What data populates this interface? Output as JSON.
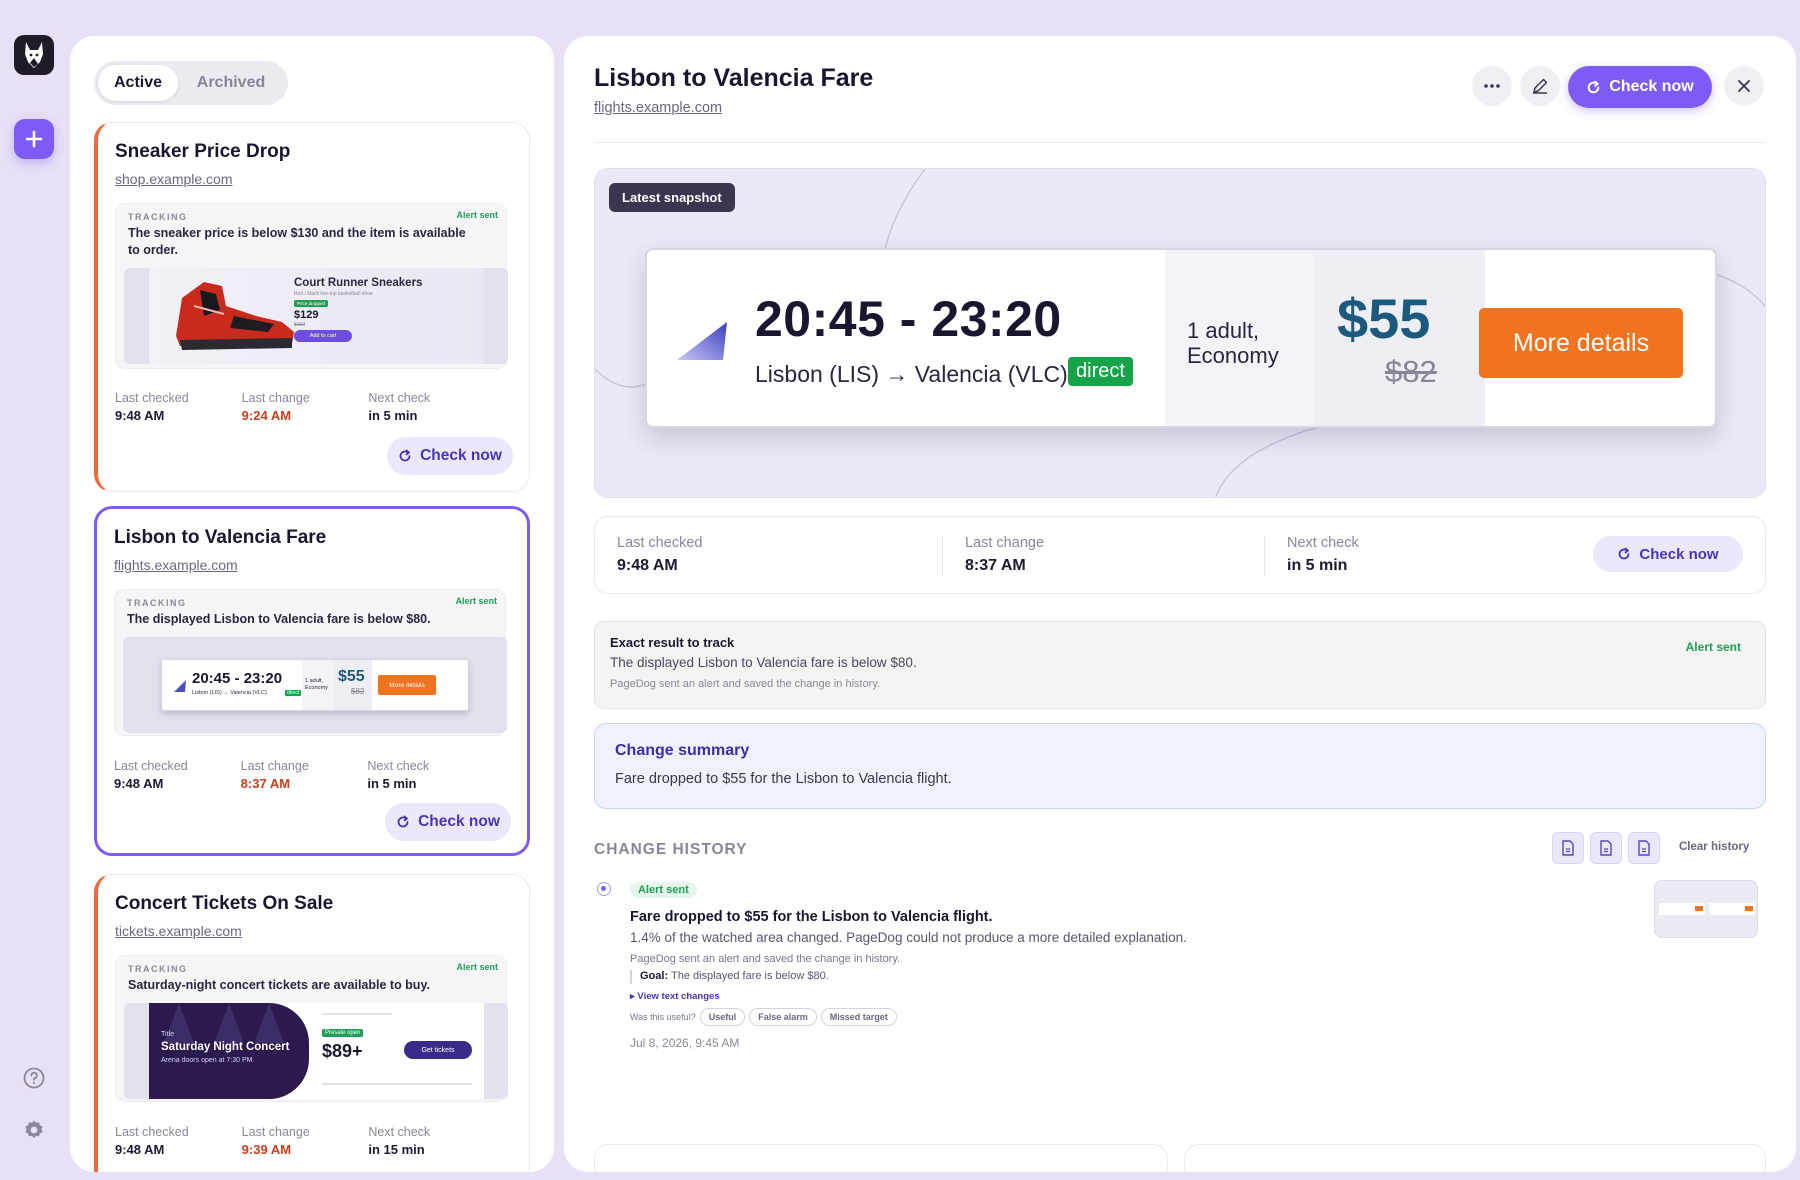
{
  "tabs": {
    "active": "Active",
    "archived": "Archived"
  },
  "common": {
    "tracking_label": "TRACKING",
    "alert_sent": "Alert sent",
    "last_checked": "Last checked",
    "last_change": "Last change",
    "next_check": "Next check",
    "check_now": "Check now"
  },
  "cards": [
    {
      "title": "Sneaker Price Drop",
      "domain": "shop.example.com",
      "tracking": "The sneaker price is below $130 and the item is available to order.",
      "last_checked": "9:48 AM",
      "last_change": "9:24 AM",
      "next_check": "in 5 min",
      "thumb": {
        "name": "Court Runner Sneakers",
        "sub": "Red / black low-top basketball shoe",
        "badge": "Price dropped",
        "price": "$129",
        "old": "$150",
        "btn": "Add to cart"
      }
    },
    {
      "title": "Lisbon to Valencia Fare",
      "domain": "flights.example.com",
      "tracking": "The displayed Lisbon to Valencia fare is below $80.",
      "last_checked": "9:48 AM",
      "last_change": "8:37 AM",
      "next_check": "in 5 min"
    },
    {
      "title": "Concert Tickets On Sale",
      "domain": "tickets.example.com",
      "tracking": "Saturday-night concert tickets are available to buy.",
      "last_checked": "9:48 AM",
      "last_change": "9:39 AM",
      "next_check": "in 15 min",
      "thumb": {
        "kicker": "Title",
        "name": "Saturday Night Concert",
        "sub": "Arena doors open at 7:30 PM",
        "badge": "Presale open",
        "price": "$89+",
        "btn": "Get tickets"
      }
    }
  ],
  "detail": {
    "title": "Lisbon to Valencia Fare",
    "domain": "flights.example.com",
    "check_now": "Check now",
    "snapshot_label": "Latest snapshot",
    "fare": {
      "times": "20:45 - 23:20",
      "route": "Lisbon (LIS) → Valencia (VLC)",
      "direct": "direct",
      "pax_line1": "1 adult,",
      "pax_line2": "Economy",
      "price": "$55",
      "old_price": "$82",
      "cta": "More details"
    },
    "stats": {
      "last_checked": "9:48 AM",
      "last_change": "8:37 AM",
      "next_check": "in 5 min"
    },
    "exact": {
      "title": "Exact result to track",
      "text": "The displayed Lisbon to Valencia fare is below $80.",
      "note": "PageDog sent an alert and saved the change in history.",
      "status": "Alert sent"
    },
    "summary": {
      "title": "Change summary",
      "text": "Fare dropped to $55 for the Lisbon to Valencia flight."
    },
    "history": {
      "heading": "CHANGE HISTORY",
      "clear": "Clear history",
      "entry": {
        "badge": "Alert sent",
        "title": "Fare dropped to $55 for the Lisbon to Valencia flight.",
        "desc": "1.4% of the watched area changed. PageDog could not produce a more detailed explanation.",
        "note": "PageDog sent an alert and saved the change in history.",
        "goal_label": "Goal:",
        "goal": "The displayed fare is below $80.",
        "view": "▸ View text changes",
        "useful_q": "Was this useful?",
        "opt_useful": "Useful",
        "opt_false": "False alarm",
        "opt_missed": "Missed target",
        "date": "Jul 8, 2026, 9:45 AM"
      }
    }
  },
  "colors": {
    "accent": "#7c5cf4",
    "alert_orange": "#ee6a3a",
    "success": "#1e9f55",
    "fare_price": "#1b5a7e",
    "cta": "#f0731f"
  },
  "icons": [
    "dog-logo-icon",
    "plus-icon",
    "help-icon",
    "gear-icon",
    "more-icon",
    "edit-icon",
    "refresh-icon",
    "close-icon",
    "document-icon"
  ]
}
